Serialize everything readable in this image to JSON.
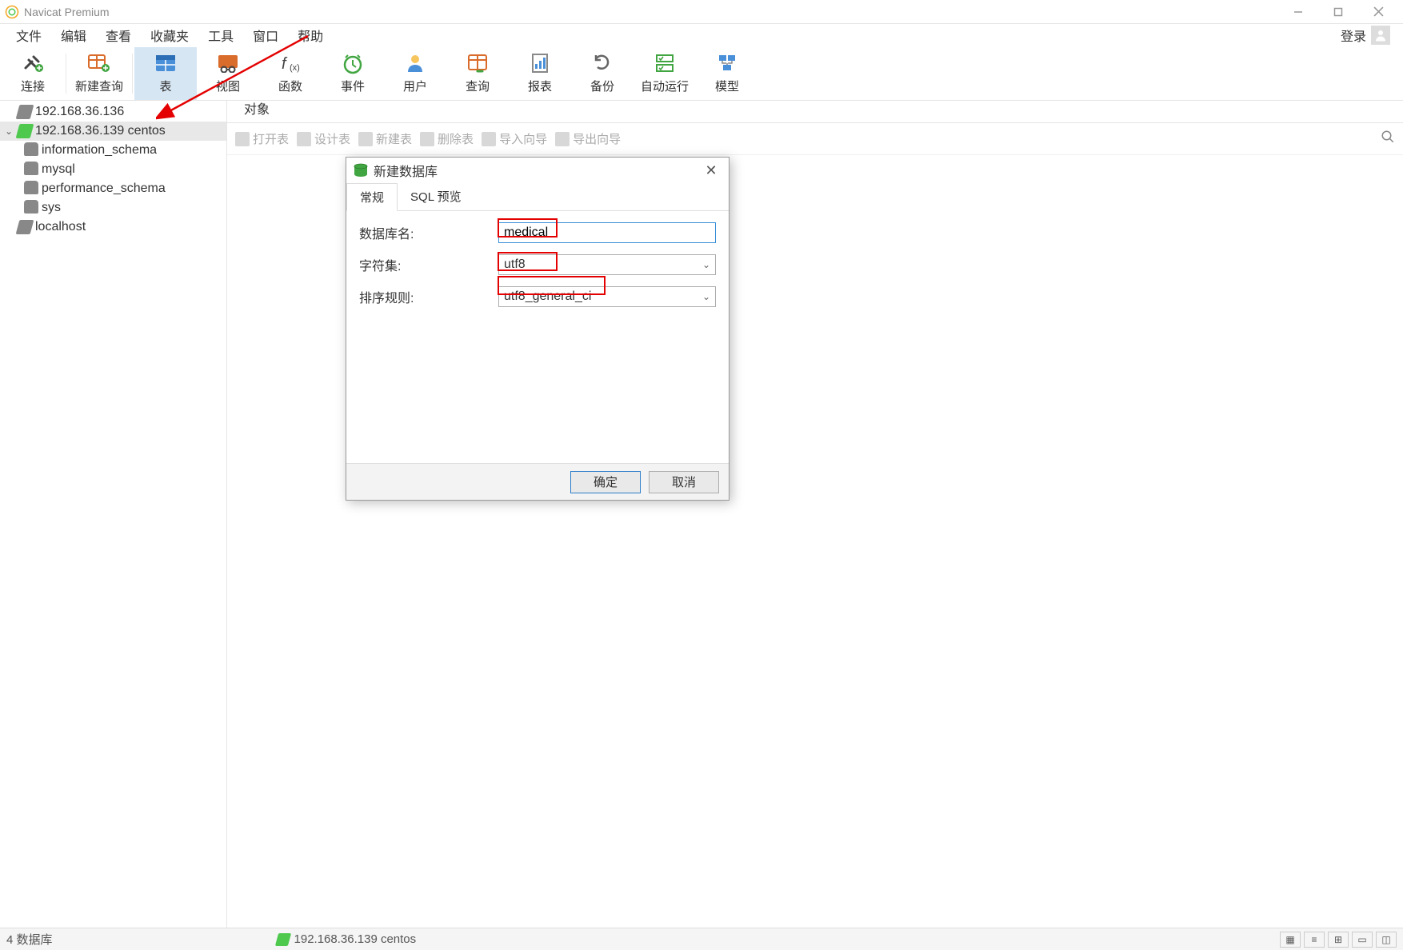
{
  "app": {
    "title": "Navicat Premium"
  },
  "menu": {
    "items": [
      "文件",
      "编辑",
      "查看",
      "收藏夹",
      "工具",
      "窗口",
      "帮助"
    ],
    "login": "登录"
  },
  "toolbar": {
    "items": [
      {
        "label": "连接"
      },
      {
        "label": "新建查询"
      },
      {
        "label": "表",
        "selected": true
      },
      {
        "label": "视图"
      },
      {
        "label": "函数"
      },
      {
        "label": "事件"
      },
      {
        "label": "用户"
      },
      {
        "label": "查询"
      },
      {
        "label": "报表"
      },
      {
        "label": "备份"
      },
      {
        "label": "自动运行"
      },
      {
        "label": "模型"
      }
    ]
  },
  "tree": {
    "nodes": [
      {
        "label": "192.168.36.136",
        "type": "conn",
        "active": false,
        "indent": 0
      },
      {
        "label": "192.168.36.139  centos",
        "type": "conn",
        "active": true,
        "indent": 0,
        "expanded": true,
        "selected": true
      },
      {
        "label": "information_schema",
        "type": "db",
        "indent": 1
      },
      {
        "label": "mysql",
        "type": "db",
        "indent": 1
      },
      {
        "label": "performance_schema",
        "type": "db",
        "indent": 1
      },
      {
        "label": "sys",
        "type": "db",
        "indent": 1
      },
      {
        "label": "localhost",
        "type": "conn",
        "active": false,
        "indent": 0
      }
    ]
  },
  "content": {
    "tabs": [
      "对象"
    ],
    "subtools": [
      "打开表",
      "设计表",
      "新建表",
      "删除表",
      "导入向导",
      "导出向导"
    ]
  },
  "dialog": {
    "title": "新建数据库",
    "tabs": [
      "常规",
      "SQL 预览"
    ],
    "fields": {
      "name_label": "数据库名:",
      "name_value": "medical",
      "charset_label": "字符集:",
      "charset_value": "utf8",
      "collation_label": "排序规则:",
      "collation_value": "utf8_general_ci"
    },
    "buttons": {
      "ok": "确定",
      "cancel": "取消"
    }
  },
  "status": {
    "left": "4 数据库",
    "conn": "192.168.36.139  centos"
  }
}
